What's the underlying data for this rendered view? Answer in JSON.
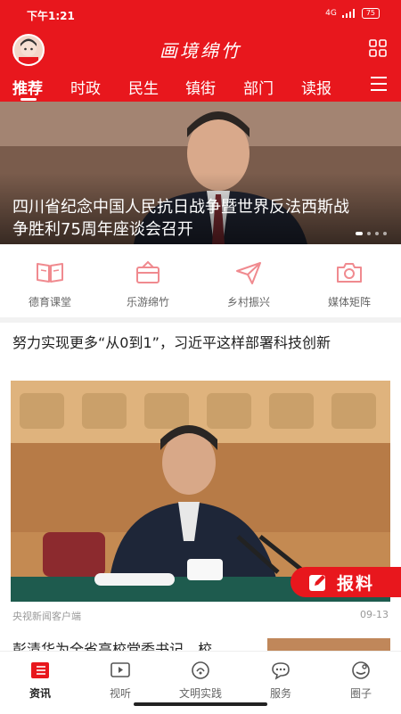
{
  "status_bar": {
    "time": "下午1:21",
    "network": "4G",
    "battery": "75"
  },
  "app": {
    "title": "画境绵竹"
  },
  "tabs": [
    {
      "label": "推荐",
      "active": true
    },
    {
      "label": "时政"
    },
    {
      "label": "民生"
    },
    {
      "label": "镇街"
    },
    {
      "label": "部门"
    },
    {
      "label": "读报"
    }
  ],
  "banner": {
    "title": "四川省纪念中国人民抗日战争暨世界反法西斯战争胜利75周年座谈会召开"
  },
  "quick_nav": [
    {
      "label": "德育课堂",
      "icon": "book-icon"
    },
    {
      "label": "乐游绵竹",
      "icon": "travel-icon"
    },
    {
      "label": "乡村振兴",
      "icon": "paper-plane-icon"
    },
    {
      "label": "媒体矩阵",
      "icon": "camera-icon"
    }
  ],
  "article": {
    "title": "努力实现更多“从0到1”，习近平这样部署科技创新",
    "source": "央视新闻客户端",
    "date": "09-13"
  },
  "next_article": {
    "title": "彭清华为全省高校党委书记、校"
  },
  "report_button": {
    "label": "报料"
  },
  "bottom_nav": [
    {
      "label": "资讯",
      "icon": "news-icon",
      "active": true
    },
    {
      "label": "视听",
      "icon": "video-icon"
    },
    {
      "label": "文明实践",
      "icon": "practice-icon"
    },
    {
      "label": "服务",
      "icon": "service-icon"
    },
    {
      "label": "圈子",
      "icon": "circle-icon"
    }
  ],
  "colors": {
    "brand": "#e8171d",
    "quick_nav_icon": "#f08a8f"
  }
}
